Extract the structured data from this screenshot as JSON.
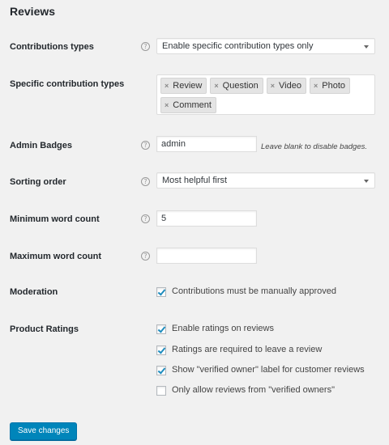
{
  "page": {
    "title": "Reviews"
  },
  "contribution_types": {
    "label": "Contributions types",
    "help": "?",
    "selected": "Enable specific contribution types only"
  },
  "specific_types": {
    "label": "Specific contribution types",
    "tags": [
      {
        "remove": "×",
        "label": "Review"
      },
      {
        "remove": "×",
        "label": "Question"
      },
      {
        "remove": "×",
        "label": "Video"
      },
      {
        "remove": "×",
        "label": "Photo"
      },
      {
        "remove": "×",
        "label": "Comment"
      }
    ]
  },
  "admin_badges": {
    "label": "Admin Badges",
    "help": "?",
    "value": "admin",
    "description": "Leave blank to disable badges."
  },
  "sorting_order": {
    "label": "Sorting order",
    "help": "?",
    "selected": "Most helpful first"
  },
  "min_word_count": {
    "label": "Minimum word count",
    "help": "?",
    "value": "5"
  },
  "max_word_count": {
    "label": "Maximum word count",
    "help": "?",
    "value": ""
  },
  "moderation": {
    "label": "Moderation",
    "option": {
      "label": "Contributions must be manually approved",
      "checked": true
    }
  },
  "product_ratings": {
    "label": "Product Ratings",
    "options": [
      {
        "label": "Enable ratings on reviews",
        "checked": true
      },
      {
        "label": "Ratings are required to leave a review",
        "checked": true
      },
      {
        "label": "Show \"verified owner\" label for customer reviews",
        "checked": true
      },
      {
        "label": "Only allow reviews from \"verified owners\"",
        "checked": false
      }
    ]
  },
  "actions": {
    "save_label": "Save changes"
  },
  "colors": {
    "accent": "#0085ba",
    "check": "#1e8cbe",
    "background": "#f1f1f1"
  }
}
